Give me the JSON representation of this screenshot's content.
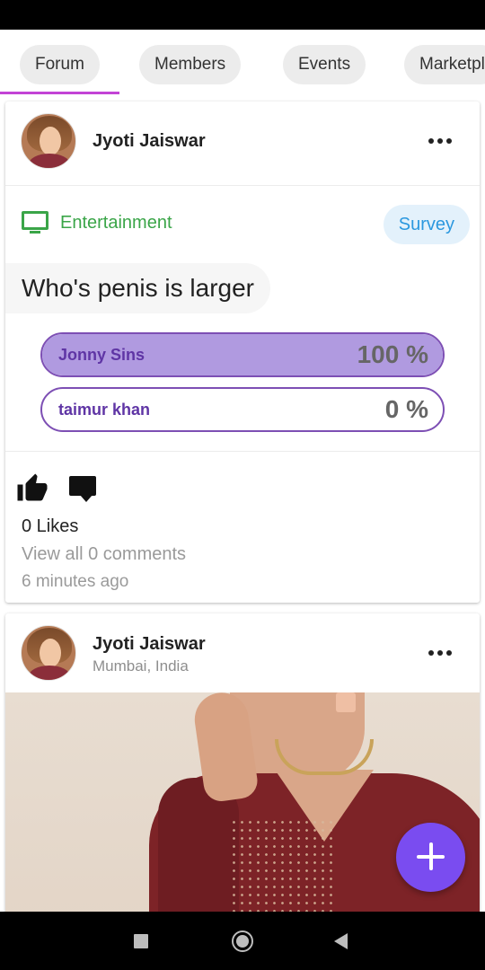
{
  "tabs": [
    {
      "label": "Forum",
      "active": true
    },
    {
      "label": "Members"
    },
    {
      "label": "Events"
    },
    {
      "label": "Marketpl"
    }
  ],
  "post1": {
    "author": "Jyoti Jaiswar",
    "category": "Entertainment",
    "badge": "Survey",
    "question": "Who's penis is larger",
    "options": [
      {
        "label": "Jonny Sins",
        "percent_text": "100 %",
        "percent": 100
      },
      {
        "label": "taimur khan",
        "percent_text": "0 %",
        "percent": 0
      }
    ],
    "likes": "0 Likes",
    "comments": "View all 0 comments",
    "time": "6 minutes ago"
  },
  "post2": {
    "author": "Jyoti Jaiswar",
    "location": "Mumbai, India"
  },
  "icons": {
    "more": "more-horizontal-icon",
    "category": "tv-icon",
    "like": "thumbs-up-icon",
    "comment": "comment-icon",
    "fab": "plus-icon"
  },
  "colors": {
    "tab_indicator": "#c343d6",
    "category": "#3aa548",
    "survey": "#2b98df",
    "poll_border": "#7d4fb4",
    "poll_fill": "#b09ae0",
    "fab": "#7a4cf0"
  }
}
